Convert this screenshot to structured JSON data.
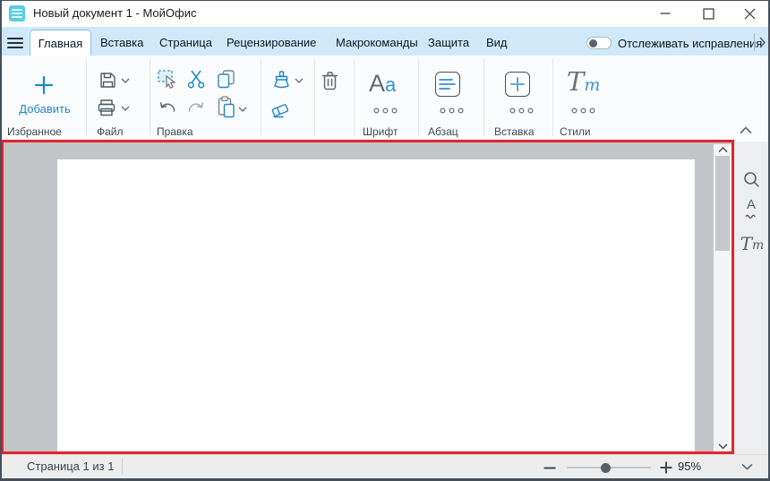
{
  "titlebar": {
    "title": "Новый документ 1 - МойОфис"
  },
  "tabbar": {
    "tabs": [
      "Главная",
      "Вставка",
      "Страница",
      "Рецензирование",
      "Макрокоманды",
      "Защита",
      "Вид"
    ],
    "active_tab": "Главная",
    "track_changes_label": "Отслеживать исправления"
  },
  "toolbar": {
    "favorites_label": "Избранное",
    "add_button_label": "Добавить",
    "file_label": "Файл",
    "edit_label": "Правка",
    "font_label": "Шрифт",
    "paragraph_label": "Абзац",
    "insert_label": "Вставка",
    "styles_label": "Стили",
    "font_icon": {
      "big": "A",
      "small": "a"
    },
    "styles_icon": {
      "big": "T",
      "small": "т"
    }
  },
  "sidebar": {
    "spellcheck_icon_letter": "A",
    "styles_icon": {
      "big": "T",
      "small": "т"
    }
  },
  "statusbar": {
    "page_indicator": "Страница 1 из 1",
    "zoom_level": "95%"
  },
  "colors": {
    "accent_blue": "#1f86c9",
    "annotation_red": "#e5252b",
    "tabbar_blue": "#cfe9fb",
    "canvas_gray": "#c3c6c9"
  }
}
